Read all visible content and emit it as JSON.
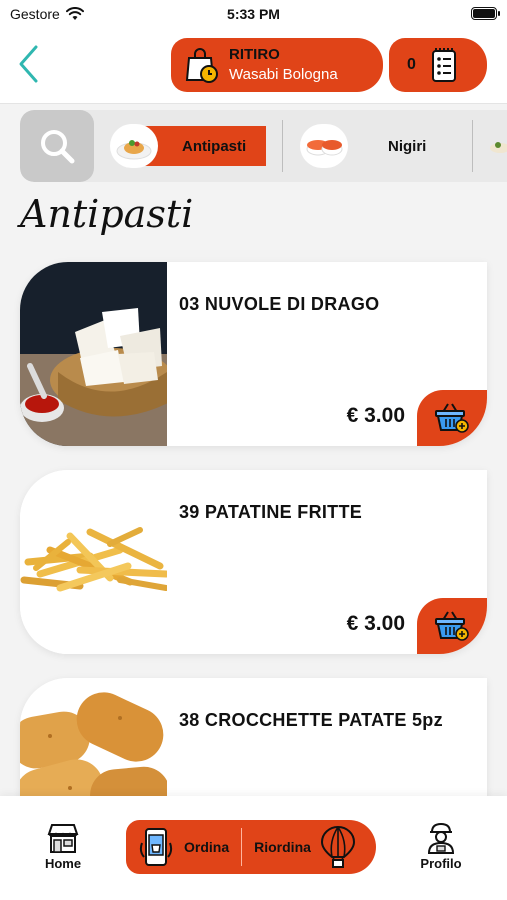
{
  "status_bar": {
    "carrier": "Gestore",
    "time": "5:33 PM"
  },
  "header": {
    "pickup_mode": "RITIRO",
    "store_name": "Wasabi Bologna",
    "cart_count": "0"
  },
  "categories": {
    "items": [
      {
        "label": "Antipasti",
        "active": true
      },
      {
        "label": "Nigiri",
        "active": false
      }
    ]
  },
  "section": {
    "title": "Antipasti"
  },
  "products": [
    {
      "name": "03 NUVOLE DI DRAGO",
      "price": "€ 3.00"
    },
    {
      "name": "39 PATATINE FRITTE",
      "price": "€ 3.00"
    },
    {
      "name": "38 CROCCHETTE PATATE 5pz",
      "price": ""
    }
  ],
  "bottom_nav": {
    "home": "Home",
    "order": "Ordina",
    "reorder": "Riordina",
    "profile": "Profilo"
  },
  "colors": {
    "accent": "#e04418",
    "back_arrow": "#2fb7b0"
  }
}
